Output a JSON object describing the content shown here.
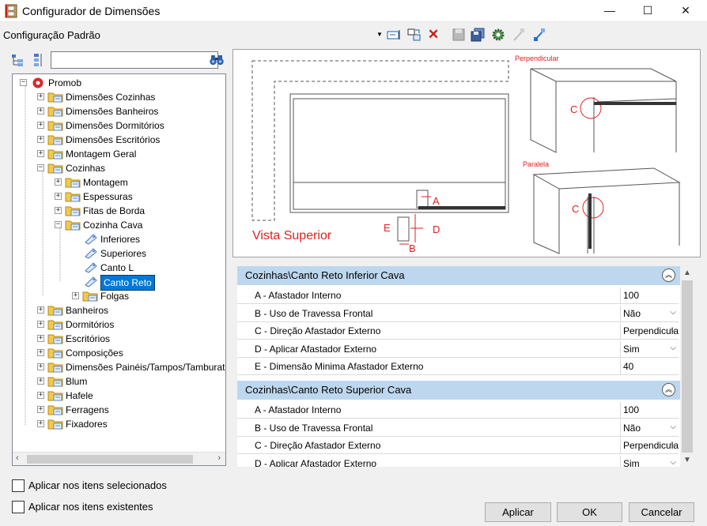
{
  "window": {
    "title": "Configurador de Dimensões",
    "min": "—",
    "max": "☐",
    "close": "✕"
  },
  "config_label": "Configuração Padrão",
  "tree": {
    "search_value": "",
    "items": [
      "Promob",
      "Dimensões Cozinhas",
      "Dimensões Banheiros",
      "Dimensões Dormitórios",
      "Dimensões Escritórios",
      "Montagem Geral",
      "Cozinhas",
      "Montagem",
      "Espessuras",
      "Fitas de Borda",
      "Cozinha Cava",
      "Inferiores",
      "Superiores",
      "Canto L",
      "Canto Reto",
      "Folgas",
      "Banheiros",
      "Dormitórios",
      "Escritórios",
      "Composições",
      "Dimensões Painéis/Tampos/Tamburatos",
      "Blum",
      "Hafele",
      "Ferragens",
      "Fixadores"
    ]
  },
  "preview": {
    "perpendicular": "Perpendicular",
    "paralela": "Paralela",
    "vista_superior": "Vista Superior",
    "label_a": "A",
    "label_b": "B",
    "label_c": "C",
    "label_d": "D",
    "label_e": "E"
  },
  "categories": [
    {
      "title": "Cozinhas\\Canto Reto Inferior Cava",
      "rows": [
        {
          "name": "A -  Afastador Interno",
          "value": "100"
        },
        {
          "name": "B -  Uso de Travessa Frontal",
          "value": "Não"
        },
        {
          "name": "C - Direção Afastador Externo",
          "value": "Perpendicular"
        },
        {
          "name": "D - Aplicar Afastador Externo",
          "value": "Sim"
        },
        {
          "name": "E - Dimensão Minima Afastador Externo",
          "value": "40"
        }
      ]
    },
    {
      "title": "Cozinhas\\Canto Reto Superior Cava",
      "rows": [
        {
          "name": "A -  Afastador Interno",
          "value": "100"
        },
        {
          "name": "B -  Uso de Travessa Frontal",
          "value": "Não"
        },
        {
          "name": "C - Direção Afastador Externo",
          "value": "Perpendicular"
        },
        {
          "name": "D - Aplicar Afastador Externo",
          "value": "Sim"
        }
      ]
    }
  ],
  "options": {
    "aplicar_selecionados": "Aplicar nos itens selecionados",
    "aplicar_existentes": "Aplicar nos itens existentes"
  },
  "buttons": {
    "aplicar": "Aplicar",
    "ok": "OK",
    "cancelar": "Cancelar"
  },
  "colors": {
    "accent": "#0078d7",
    "category_bg": "#bdd7ee",
    "drawing_red": "#e02020"
  }
}
